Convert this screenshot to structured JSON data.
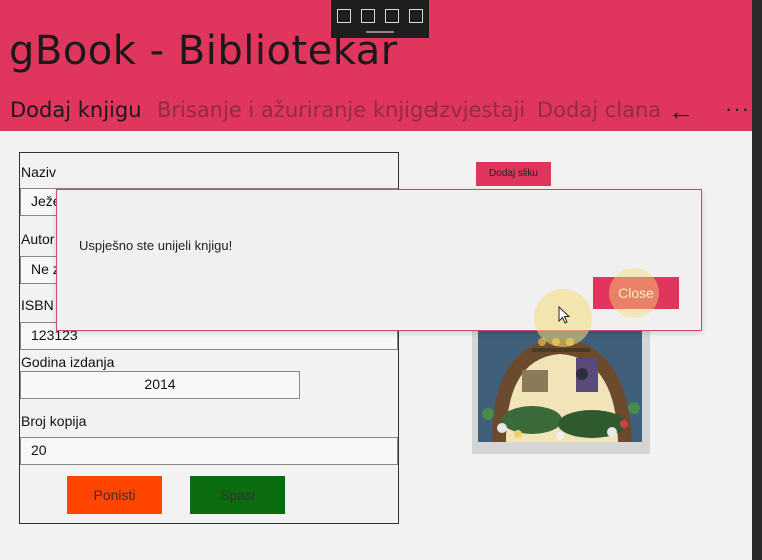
{
  "app": {
    "title": "gBook - Bibliotekar"
  },
  "tabs": [
    {
      "label": "Dodaj knjigu"
    },
    {
      "label": "Brisanje i ažuriranje knjige"
    },
    {
      "label": "Izvjestaji"
    },
    {
      "label": "Dodaj clana"
    }
  ],
  "icons": {
    "back": "←",
    "more": "···"
  },
  "form": {
    "naziv_label": "Naziv",
    "naziv_value": "Ježe",
    "autor_label": "Autor",
    "autor_value": "Ne z",
    "isbn_label": "ISBN",
    "isbn_value": "123123",
    "godina_label": "Godina izdanja",
    "godina_value": "2014",
    "kopije_label": "Broj kopija",
    "kopije_value": "20",
    "reset_label": "Ponisti",
    "save_label": "Spasi"
  },
  "image_panel": {
    "add_image_label": "Dodaj sliku"
  },
  "dialog": {
    "message": "Uspješno ste unijeli knjigu!",
    "close_label": "Close"
  },
  "colors": {
    "accent": "#e0355c",
    "reset_button": "#ff4500",
    "save_button": "#0b6b0f"
  }
}
